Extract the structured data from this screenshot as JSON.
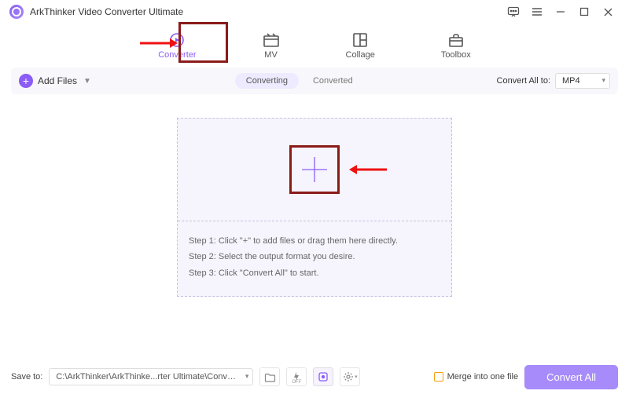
{
  "titlebar": {
    "title": "ArkThinker Video Converter Ultimate"
  },
  "nav": {
    "converter": "Converter",
    "mv": "MV",
    "collage": "Collage",
    "toolbox": "Toolbox"
  },
  "toolbar": {
    "add_files": "Add Files",
    "tab_converting": "Converting",
    "tab_converted": "Converted",
    "convert_all_to": "Convert All to:",
    "format": "MP4"
  },
  "drop": {
    "step1": "Step 1: Click \"+\" to add files or drag them here directly.",
    "step2": "Step 2: Select the output format you desire.",
    "step3": "Step 3: Click \"Convert All\" to start."
  },
  "footer": {
    "save_to": "Save to:",
    "path": "C:\\ArkThinker\\ArkThinke...rter Ultimate\\Converted",
    "merge": "Merge into one file",
    "convert_all": "Convert All"
  }
}
